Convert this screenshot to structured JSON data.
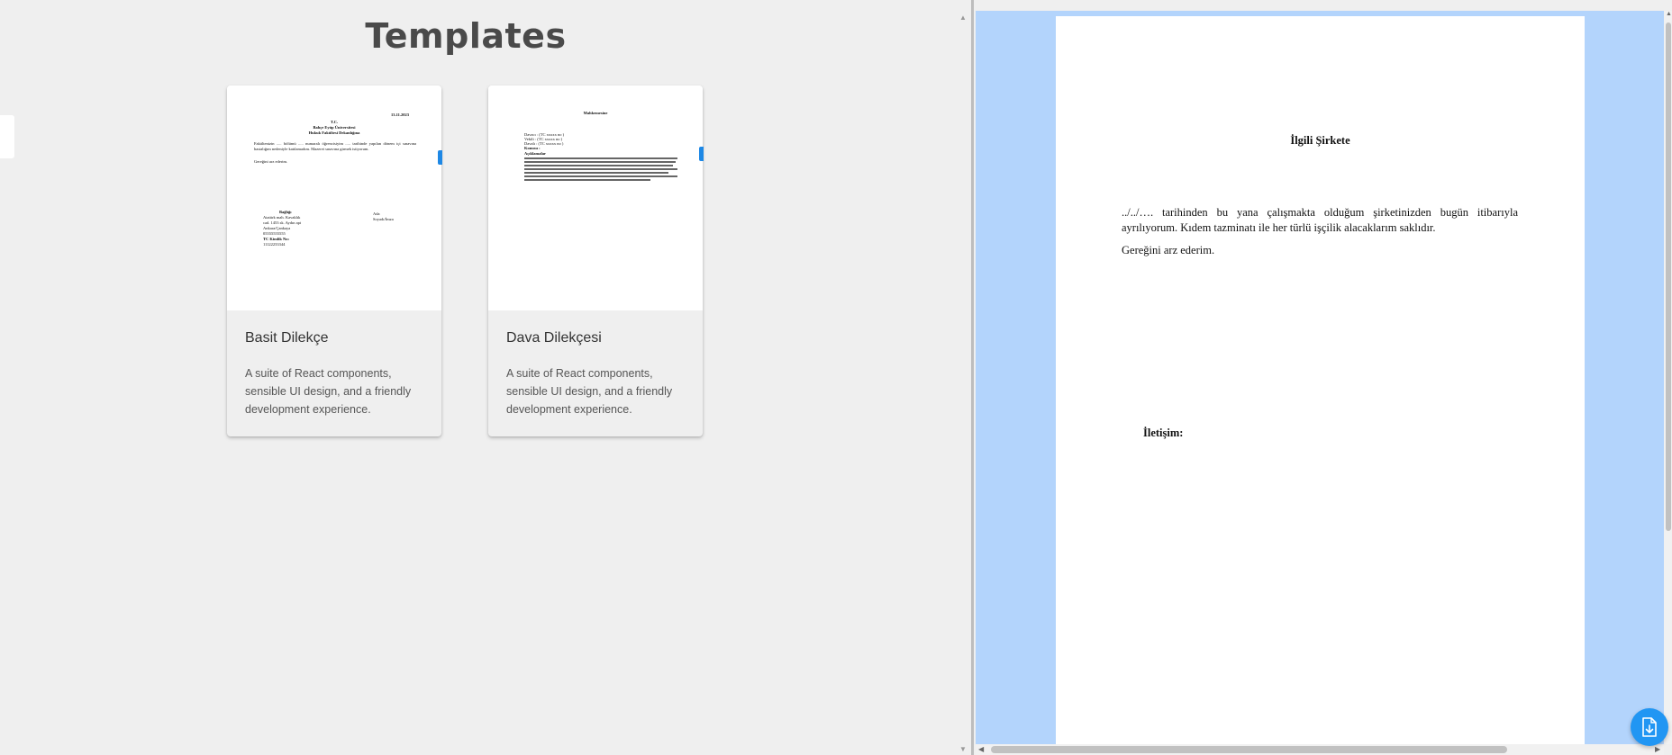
{
  "page": {
    "title": "Templates"
  },
  "templates": [
    {
      "title": "Basit Dilekçe",
      "description": "A suite of React components, sensible UI design, and a friendly development experience.",
      "thumbnail": {
        "date": "13.11.2023",
        "header1": "T.C.",
        "header2": "Bahçe Eyüp Üniversitesi",
        "header3": "Hukuk Fakültesi Dekanlığına",
        "body": "Fakültenizin ..... bölümü ..... numaralı öğrencisiyim ..... tarihinde yapılan dönem içi sınavına hastalığım nedeniyle katılamadım. Mazeret sınavına girmek istiyorum.",
        "closing": "Gereğini arz ederim.",
        "address_label": "Bağlığı",
        "address_lines": [
          "Atatürk mah. Kavaklık",
          "cad. 1453 sk. Aydın apt",
          "Ankara/Çankaya",
          "05555555555"
        ],
        "tc_label": "TC Kimlik No:",
        "tc_value": "11122233344",
        "sign_label": "Ada",
        "sign_value": "Soyadı/İmza"
      }
    },
    {
      "title": "Dava Dilekçesi",
      "description": "A suite of React components, sensible UI design, and a friendly development experience.",
      "thumbnail": {
        "heading": "Mahkemesine",
        "fields": [
          "Davacı : (TC xxxxx no )",
          "Vekili : (TC xxxxx no )",
          "Davalı : (TC xxxxx no )",
          "Konusu :"
        ],
        "section": "Açıklamalar",
        "paragraphs": 5
      }
    }
  ],
  "preview": {
    "heading": "İlgili Şirkete",
    "body": "../../…. tarihinden bu yana çalışmakta olduğum şirketinizden bugün itibarıyla ayrılıyorum. Kıdem tazminatı ile her türlü işçilik alacaklarım saklıdır.",
    "closing": "Gereğini arz ederim.",
    "contact_label": "İletişim:"
  },
  "icons": {
    "download": "file-download-icon",
    "accent": "#2196f3"
  }
}
